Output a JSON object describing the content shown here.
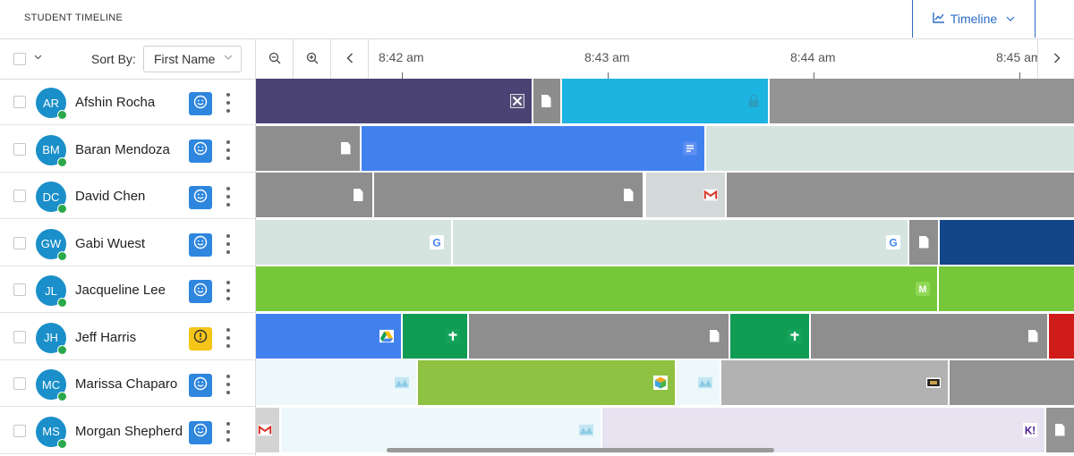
{
  "header": {
    "title": "STUDENT TIMELINE",
    "view_label": "Timeline"
  },
  "toolbar": {
    "sort_label": "Sort By:",
    "sort_value": "First Name"
  },
  "axis": {
    "ticks": [
      "8:42 am",
      "8:43 am",
      "8:44 am",
      "8:45 am"
    ]
  },
  "colors": {
    "accent": "#2b6cc4",
    "avatar": "#1a8fc9",
    "online": "#2aa84a",
    "status_ok": "#2e86de",
    "status_warn": "#f5c518"
  },
  "students": [
    {
      "initials": "AR",
      "name": "Afshin Rocha",
      "status": "ok",
      "segments": [
        {
          "color": "#4a4374",
          "icon": "x-app-icon"
        },
        {
          "color": "#8c8c8c",
          "icon": "doc-icon"
        },
        {
          "color": "#1db4e2",
          "icon": "lock-icon"
        },
        {
          "color": "#939393",
          "icon": ""
        }
      ]
    },
    {
      "initials": "BM",
      "name": "Baran Mendoza",
      "status": "ok",
      "segments": [
        {
          "color": "#8e8e8e",
          "icon": "doc-icon"
        },
        {
          "color": "#4181ee",
          "icon": "forms-icon"
        },
        {
          "color": "#d6e4e0",
          "icon": ""
        }
      ]
    },
    {
      "initials": "DC",
      "name": "David Chen",
      "status": "ok",
      "segments": [
        {
          "color": "#8e8e8e",
          "icon": "doc-icon"
        },
        {
          "color": "#8e8e8e",
          "icon": "doc-icon"
        },
        {
          "color": "#d3d9d8",
          "icon": "gmail-icon"
        },
        {
          "color": "#929292",
          "icon": ""
        }
      ]
    },
    {
      "initials": "GW",
      "name": "Gabi Wuest",
      "status": "ok",
      "segments": [
        {
          "color": "#d6e4e0",
          "icon": "google-icon"
        },
        {
          "color": "#d6e4e0",
          "icon": "google-icon"
        },
        {
          "color": "#8e8e8e",
          "icon": "doc-icon"
        },
        {
          "color": "#124689",
          "icon": ""
        }
      ]
    },
    {
      "initials": "JL",
      "name": "Jacqueline Lee",
      "status": "ok",
      "segments": [
        {
          "color": "#76c73a",
          "icon": "m-app-icon"
        },
        {
          "color": "#76c73a",
          "icon": ""
        }
      ]
    },
    {
      "initials": "JH",
      "name": "Jeff Harris",
      "status": "warn",
      "segments": [
        {
          "color": "#4181ee",
          "icon": "drive-icon"
        },
        {
          "color": "#119c53",
          "icon": "cross-icon"
        },
        {
          "color": "#8e8e8e",
          "icon": "doc-icon"
        },
        {
          "color": "#119c53",
          "icon": "cross-icon"
        },
        {
          "color": "#8e8e8e",
          "icon": "doc-icon"
        },
        {
          "color": "#d01b1b",
          "icon": ""
        }
      ]
    },
    {
      "initials": "MC",
      "name": "Marissa Chaparo",
      "status": "ok",
      "segments": [
        {
          "color": "#eef8fb",
          "icon": "map-icon"
        },
        {
          "color": "#8fc142",
          "icon": "cube-icon"
        },
        {
          "color": "#eef8fb",
          "icon": "map-icon"
        },
        {
          "color": "#b2b2b2",
          "icon": "film-icon"
        },
        {
          "color": "#939393",
          "icon": ""
        }
      ]
    },
    {
      "initials": "MS",
      "name": "Morgan Shepherd",
      "status": "ok",
      "segments": [
        {
          "color": "#d3d3d3",
          "icon": "gmail-icon"
        },
        {
          "color": "#eef8fb",
          "icon": "map-icon"
        },
        {
          "color": "#e7e3f1",
          "icon": "kahoot-icon"
        },
        {
          "color": "#939393",
          "icon": "doc-icon"
        }
      ]
    }
  ]
}
